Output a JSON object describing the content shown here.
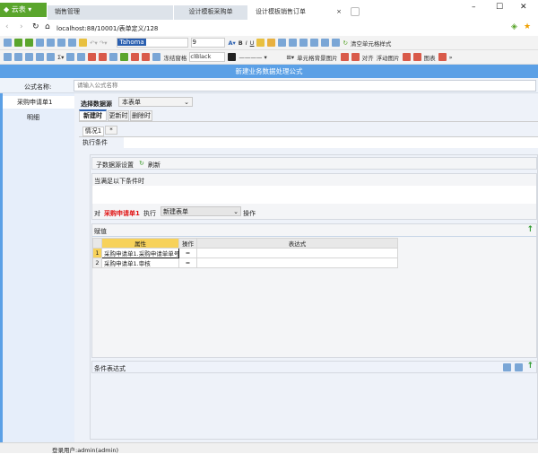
{
  "browser": {
    "brand": "云表",
    "tabs": [
      "销售管理",
      "设计模板采购单",
      "设计模板销售订单"
    ],
    "url": "localhost:88/10001/表单定义/128"
  },
  "toolbar": {
    "font": "Tahoma",
    "size": "9",
    "clear_format": "清空单元格样式",
    "freeze": "冻结窗格",
    "color_name": "clBlack",
    "cell_bg": "单元格背景图片",
    "align": "对齐",
    "float_image": "浮动图片",
    "chart": "图表"
  },
  "dialog": {
    "title": "新建业务数据处理公式",
    "name_label": "公式名称:",
    "name_placeholder": "请输入公式名称"
  },
  "sidebar": {
    "items": [
      "采购申请单1",
      "明细"
    ]
  },
  "main": {
    "source_label": "选择数据源",
    "source_value": "本表单",
    "tabs": [
      "新建时",
      "更新时",
      "删除时"
    ],
    "case_tabs": [
      "情况1",
      "*"
    ],
    "exec_condition": "执行条件",
    "sub_source": "子数据源设置",
    "refresh": "刷新",
    "when_label": "当满足以下条件时",
    "on_label": "对",
    "target": "采购申请单1",
    "exec_label": "执行",
    "action": "新建表单",
    "op_label": "操作",
    "assign_label": "赋值",
    "columns": [
      "属性",
      "操作",
      "表达式"
    ],
    "rows": [
      {
        "n": "1",
        "attr": "采购申请单1.采购申请单单号",
        "op": "=",
        "expr": ""
      },
      {
        "n": "2",
        "attr": "采购申请单1.审核",
        "op": "=",
        "expr": ""
      }
    ],
    "cond_expr": "条件表达式",
    "target_color": "#e01010"
  },
  "status": {
    "user": "登录用户:admin(admin)"
  }
}
